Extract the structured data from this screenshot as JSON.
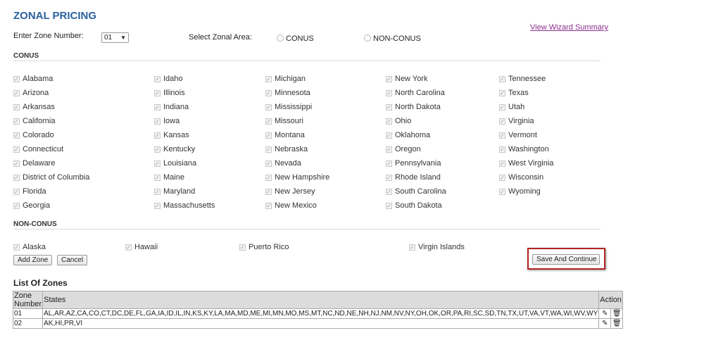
{
  "page": {
    "title": "ZONAL PRICING",
    "zone_number_label": "Enter Zone Number:",
    "zone_number_value": "01",
    "zonal_area_label": "Select Zonal Area:",
    "radio_conus": "CONUS",
    "radio_nonconus": "NON-CONUS",
    "wizard_link": "View Wizard Summary"
  },
  "conus": {
    "heading": "CONUS",
    "col1": [
      "Alabama",
      "Arizona",
      "Arkansas",
      "California",
      "Colorado",
      "Connecticut",
      "Delaware",
      "District of Columbia",
      "Florida",
      "Georgia"
    ],
    "col2": [
      "Idaho",
      "Illinois",
      "Indiana",
      "Iowa",
      "Kansas",
      "Kentucky",
      "Louisiana",
      "Maine",
      "Maryland",
      "Massachusetts"
    ],
    "col3": [
      "Michigan",
      "Minnesota",
      "Mississippi",
      "Missouri",
      "Montana",
      "Nebraska",
      "Nevada",
      "New Hampshire",
      "New Jersey",
      "New Mexico"
    ],
    "col4": [
      "New York",
      "North Carolina",
      "North Dakota",
      "Ohio",
      "Oklahoma",
      "Oregon",
      "Pennsylvania",
      "Rhode Island",
      "South Carolina",
      "South Dakota"
    ],
    "col5": [
      "Tennessee",
      "Texas",
      "Utah",
      "Virginia",
      "Vermont",
      "Washington",
      "West Virginia",
      "Wisconsin",
      "Wyoming"
    ]
  },
  "nonconus": {
    "heading": "NON-CONUS",
    "items": [
      "Alaska",
      "Hawaii",
      "Puerto Rico",
      "Virgin Islands"
    ]
  },
  "buttons": {
    "add_zone": "Add Zone",
    "cancel": "Cancel",
    "save_continue": "Save And Continue"
  },
  "zones": {
    "title": "List Of Zones",
    "headers": {
      "zone_number": "Zone Number",
      "states": "States",
      "action": "Action"
    },
    "rows": [
      {
        "zone": "01",
        "states": "AL,AR,AZ,CA,CO,CT,DC,DE,FL,GA,IA,ID,IL,IN,KS,KY,LA,MA,MD,ME,MI,MN,MO,MS,MT,NC,ND,NE,NH,NJ,NM,NV,NY,OH,OK,OR,PA,RI,SC,SD,TN,TX,UT,VA,VT,WA,WI,WV,WY"
      },
      {
        "zone": "02",
        "states": "AK,HI,PR,VI"
      }
    ]
  },
  "icons": {
    "checkbox": "check-icon",
    "edit": "pencil-icon",
    "delete": "trash-icon",
    "dropdown": "chevron-down-icon"
  }
}
